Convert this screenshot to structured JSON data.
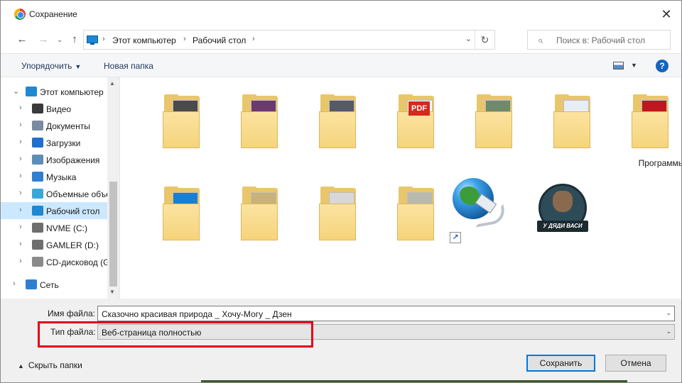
{
  "window": {
    "title": "Сохранение"
  },
  "nav": {
    "breadcrumbs": [
      "Этот компьютер",
      "Рабочий стол"
    ],
    "search_placeholder": "Поиск в: Рабочий стол"
  },
  "toolbar": {
    "organize": "Упорядочить",
    "new_folder": "Новая папка"
  },
  "sidebar": {
    "items": [
      {
        "label": "Этот компьютер",
        "icon": "computer-icon",
        "color": "#1e88d2"
      },
      {
        "label": "Видео",
        "icon": "video-icon",
        "color": "#3a3a3a"
      },
      {
        "label": "Документы",
        "icon": "documents-icon",
        "color": "#7a8aa0"
      },
      {
        "label": "Загрузки",
        "icon": "downloads-icon",
        "color": "#1e6fcf"
      },
      {
        "label": "Изображения",
        "icon": "pictures-icon",
        "color": "#5b8db8"
      },
      {
        "label": "Музыка",
        "icon": "music-icon",
        "color": "#2f7fd0"
      },
      {
        "label": "Объемные объекты",
        "icon": "3d-objects-icon",
        "color": "#3aa7d9"
      },
      {
        "label": "Рабочий стол",
        "icon": "desktop-icon",
        "color": "#1e88d2"
      },
      {
        "label": "NVME (C:)",
        "icon": "drive-icon",
        "color": "#6e6e6e"
      },
      {
        "label": "GAMLER (D:)",
        "icon": "drive-icon",
        "color": "#6e6e6e"
      },
      {
        "label": "CD-дисковод (G:)",
        "icon": "cd-drive-icon",
        "color": "#8a8a8a"
      },
      {
        "label": "Сеть",
        "icon": "network-icon",
        "color": "#2f7fd0"
      }
    ]
  },
  "files": [
    {
      "label": "",
      "icon": "folder-icon",
      "preview": "#4a4a4a"
    },
    {
      "label": "",
      "icon": "folder-icon",
      "preview": "#6b3a6e"
    },
    {
      "label": "",
      "icon": "folder-icon",
      "preview": "#555a66"
    },
    {
      "label": "",
      "icon": "folder-pdf-icon",
      "preview": "#ffffff"
    },
    {
      "label": "",
      "icon": "folder-icon",
      "preview": "#6f8a6a"
    },
    {
      "label": "",
      "icon": "folder-icon",
      "preview": "#e8eef5"
    },
    {
      "label": "Программы",
      "icon": "folder-icon",
      "preview": "#c0161f"
    },
    {
      "label": "",
      "icon": "folder-icon",
      "preview": "#1a7fd0"
    },
    {
      "label": "",
      "icon": "folder-icon",
      "preview": "#c8b27a"
    },
    {
      "label": "",
      "icon": "folder-icon",
      "preview": "#d8d8d8"
    },
    {
      "label": "",
      "icon": "folder-icon",
      "preview": "#b9b9ae"
    }
  ],
  "pdf_badge": "PDF",
  "badge_text": "У ДЯДИ ВАСИ",
  "bottom": {
    "filename_label": "Имя файла:",
    "filename_value": "Сказочно красивая природа _ Хочу-Могу _ Дзен",
    "filetype_label": "Тип файла:",
    "filetype_value": "Веб-страница полностью",
    "hide_folders": "Скрыть папки",
    "save": "Сохранить",
    "cancel": "Отмена"
  },
  "colors": {
    "highlight": "#e3001b",
    "accent": "#0078d7",
    "selected": "#cce8ff"
  }
}
